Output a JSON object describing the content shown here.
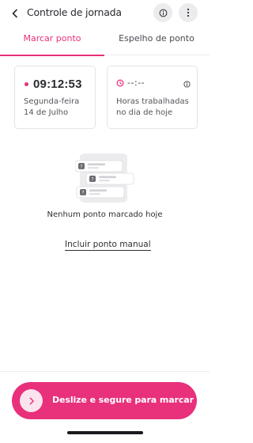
{
  "header": {
    "title": "Controle de jornada",
    "back_icon": "chevron-left-icon",
    "info_icon": "info-icon",
    "more_icon": "more-vertical-icon"
  },
  "tabs": [
    {
      "label": "Marcar ponto",
      "active": true
    },
    {
      "label": "Espelho de ponto",
      "active": false
    }
  ],
  "clock_card": {
    "time": "09:12:53",
    "weekday": "Segunda-feira",
    "date": "14 de Julho"
  },
  "hours_card": {
    "value": "--:--",
    "label_line1": "Horas trabalhadas",
    "label_line2": "no dia de hoje"
  },
  "empty_state": {
    "message": "Nenhum ponto marcado hoje",
    "manual_link": "Incluir ponto manual"
  },
  "slide_action": {
    "label": "Deslize e segure para marcar"
  },
  "colors": {
    "accent": "#e8307b",
    "accent_soft": "#fbe4ee"
  }
}
